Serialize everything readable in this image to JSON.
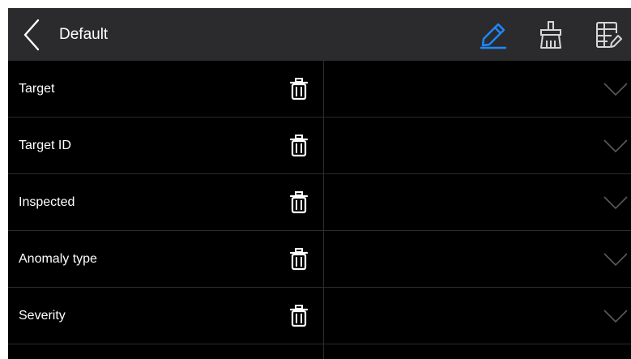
{
  "header": {
    "title": "Default",
    "back_icon": "chevron-left-icon",
    "tools": [
      {
        "icon": "pencil-edit-icon",
        "color": "#1e88ff"
      },
      {
        "icon": "broom-clean-icon",
        "color": "#d6d6d6"
      },
      {
        "icon": "form-edit-icon",
        "color": "#d6d6d6"
      }
    ]
  },
  "fields": [
    {
      "label": "Target",
      "value": ""
    },
    {
      "label": "Target ID",
      "value": ""
    },
    {
      "label": "Inspected",
      "value": ""
    },
    {
      "label": "Anomaly type",
      "value": ""
    },
    {
      "label": "Severity",
      "value": ""
    }
  ],
  "icons": {
    "delete": "trash-icon",
    "dropdown": "chevron-down-icon"
  },
  "colors": {
    "topbar": "#2b2b2d",
    "background": "#000000",
    "accent": "#1e88ff"
  }
}
